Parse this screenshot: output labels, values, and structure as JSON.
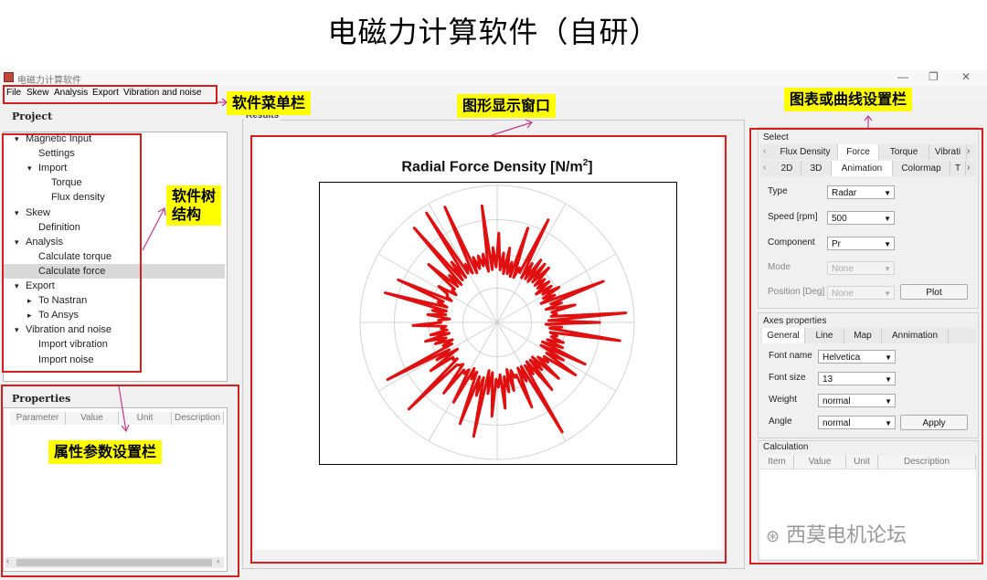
{
  "slide_title": "电磁力计算软件（自研）",
  "window": {
    "title": "电磁力计算软件",
    "minimize_glyph": "—",
    "restore_glyph": "❐",
    "close_glyph": "✕"
  },
  "menu": [
    "File",
    "Skew",
    "Analysis",
    "Export",
    "Vibration and noise"
  ],
  "project": {
    "title": "Project",
    "tree": [
      {
        "label": "Magnetic Input",
        "toggle": "▾"
      },
      {
        "label": "Settings",
        "toggle": ""
      },
      {
        "label": "Import",
        "toggle": "▾"
      },
      {
        "label": "Torque",
        "toggle": ""
      },
      {
        "label": "Flux density",
        "toggle": ""
      },
      {
        "label": "Skew",
        "toggle": "▾"
      },
      {
        "label": "Definition",
        "toggle": ""
      },
      {
        "label": "Analysis",
        "toggle": "▾"
      },
      {
        "label": "Calculate torque",
        "toggle": ""
      },
      {
        "label": "Calculate force",
        "toggle": ""
      },
      {
        "label": "Export",
        "toggle": "▾"
      },
      {
        "label": "To Nastran",
        "toggle": "▸"
      },
      {
        "label": "To Ansys",
        "toggle": "▸"
      },
      {
        "label": "Vibration and noise",
        "toggle": "▾"
      },
      {
        "label": "Import vibration",
        "toggle": ""
      },
      {
        "label": "Import noise",
        "toggle": ""
      }
    ],
    "selected_label": "Calculate force"
  },
  "properties": {
    "title": "Properties",
    "columns": [
      "Parameter",
      "Value",
      "Unit",
      "Description"
    ]
  },
  "results": {
    "title": "Results",
    "plot_title": "Radial Force Density [N/m",
    "plot_title_sup": "2",
    "plot_title_end": "]",
    "plot_color": "#e01010"
  },
  "select": {
    "title": "Select",
    "tabs_row1": [
      "Flux Density",
      "Force",
      "Torque",
      "Vibrati"
    ],
    "tabs_row2": [
      "2D",
      "3D",
      "Animation",
      "Colormap",
      "T"
    ],
    "scroll_left": "‹",
    "scroll_right": "›",
    "fields": [
      {
        "label": "Type",
        "value": "Radar",
        "enabled": true
      },
      {
        "label": "Speed [rpm]",
        "value": "500",
        "enabled": true
      },
      {
        "label": "Component",
        "value": "Pr",
        "enabled": true
      },
      {
        "label": "Mode",
        "value": "None",
        "enabled": false
      },
      {
        "label": "Position [Deg]",
        "value": "None",
        "enabled": false
      }
    ],
    "plot_button": "Plot"
  },
  "axes_properties": {
    "title": "Axes properties",
    "tabs": [
      "General",
      "Line",
      "Map",
      "Annimation"
    ],
    "fields": [
      {
        "label": "Font name",
        "value": "Helvetica"
      },
      {
        "label": "Font size",
        "value": "13"
      },
      {
        "label": "Weight",
        "value": "normal"
      },
      {
        "label": "Angle",
        "value": "normal"
      }
    ],
    "apply_button": "Apply"
  },
  "calculation": {
    "title": "Calculation",
    "columns": [
      "Item",
      "Value",
      "Unit",
      "Description"
    ]
  },
  "annotations": {
    "menu": "软件菜单栏",
    "tree_line1": "软件树",
    "tree_line2": "结构",
    "plot_window": "图形显示窗口",
    "settings": "图表或曲线设置栏",
    "properties": "属性参数设置栏"
  },
  "watermark": "西莫电机论坛",
  "highlight_color": "#d41f1f",
  "callout_color": "#ffff00",
  "icons": {
    "expand": "caret-down-icon",
    "collapse": "caret-right-icon",
    "dropdown": "triangle-down-icon"
  }
}
